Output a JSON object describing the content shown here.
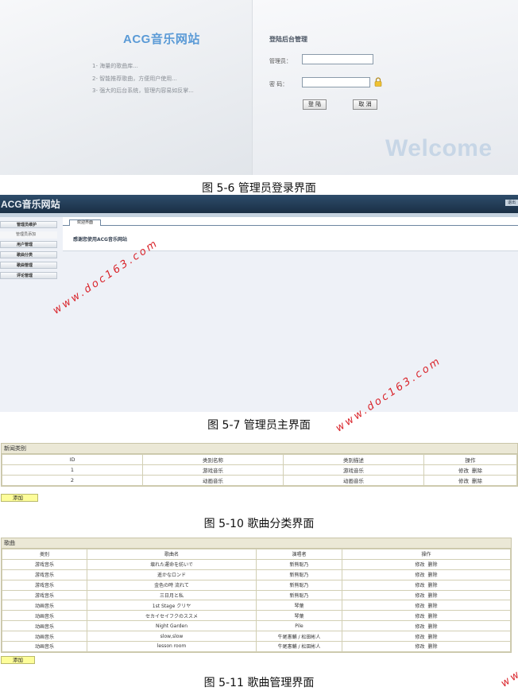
{
  "fig1": {
    "site_title": "ACG音乐网站",
    "features": [
      "1- 海量的歌曲库...",
      "2- 智能推荐歌曲，方便用户使用...",
      "3- 强大的后台系统，管理内容易如反掌..."
    ],
    "login_title": "登陆后台管理",
    "admin_label": "管理员：",
    "password_label": "密  码：",
    "admin_value": "",
    "password_value": "",
    "login_button": "登 陆",
    "cancel_button": "取 消",
    "welcome_text": "Welcome",
    "caption": "图 5-6 管理员登录界面"
  },
  "fig2": {
    "brand": "ACG音乐网站",
    "logout": "退出",
    "menu_header": "管理员维护",
    "menu_sub": "管理员添加",
    "menu_items": [
      "用户管理",
      "歌曲分类",
      "歌曲管理",
      "评论管理"
    ],
    "tab": "欢迎界面",
    "greeting": "感谢您使用ACG音乐网站",
    "caption": "图 5-7 管理员主界面"
  },
  "watermark": "www.doc163.com",
  "fig3": {
    "title": "新闻类别",
    "headers": [
      "ID",
      "类别名称",
      "类别描述",
      "操作"
    ],
    "rows": [
      [
        "1",
        "游戏音乐",
        "游戏音乐"
      ],
      [
        "2",
        "动画音乐",
        "动画音乐"
      ]
    ],
    "op_edit": "修改",
    "op_delete": "删除",
    "add_button": "添加",
    "caption": "图 5-10 歌曲分类界面"
  },
  "fig4": {
    "title": "歌曲",
    "headers": [
      "类别",
      "歌曲名",
      "演唱者",
      "操作"
    ],
    "rows": [
      [
        "游戏音乐",
        "壊れた運命を紡いで",
        "新熊聡乃"
      ],
      [
        "游戏音乐",
        "遥かなロンド",
        "新熊聡乃"
      ],
      [
        "游戏音乐",
        "金色の時 流れて",
        "新熊聡乃"
      ],
      [
        "游戏音乐",
        "三日月と私",
        "新熊聡乃"
      ],
      [
        "动画音乐",
        "1st Stage クリヤ",
        "琴葉"
      ],
      [
        "动画音乐",
        "セカイセイフクのススメ",
        "琴葉"
      ],
      [
        "动画音乐",
        "Night Garden",
        "Pile"
      ],
      [
        "动画音乐",
        "slow,slow",
        "牛尾憲輔 / 松田彬人"
      ],
      [
        "动画音乐",
        "lesson room",
        "牛尾憲輔 / 松田彬人"
      ]
    ],
    "op_edit": "修改",
    "op_delete": "删除",
    "add_button": "添加",
    "caption": "图 5-11 歌曲管理界面"
  }
}
